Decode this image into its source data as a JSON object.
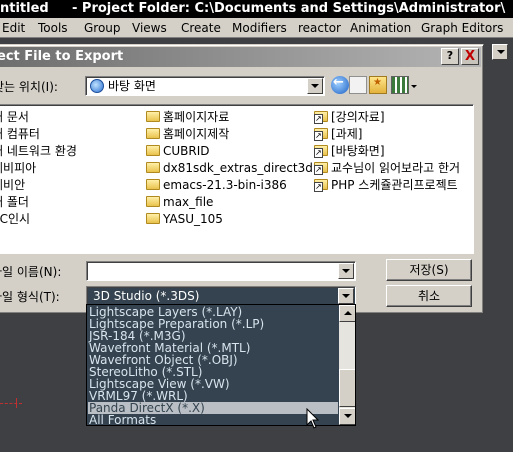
{
  "app": {
    "title_prefix": "ntitled",
    "title_project": "- Project Folder: C:\\Documents and Settings\\Administrator\\"
  },
  "menubar": {
    "items": [
      "Edit",
      "Tools",
      "Group",
      "Views",
      "Create",
      "Modifiers",
      "reactor",
      "Animation",
      "Graph Editors"
    ]
  },
  "dialog": {
    "title": "ect File to Export",
    "help_button": "?",
    "close_button": "X",
    "lookin_label": "찾는 위치(I):",
    "lookin_value": "바탕 화면",
    "files_col1": [
      "내 문서",
      "내 컴퓨터",
      "내 네트워크 환경",
      "웨비피아",
      "웨비안",
      "새 폴더",
      "SC인시"
    ],
    "files_col2": [
      "홈페이지자료",
      "홈페이지제작",
      "CUBRID",
      "dx81sdk_extras_direct3d",
      "emacs-21.3-bin-i386",
      "max_file",
      "YASU_105"
    ],
    "files_col3": [
      "[강의자료]",
      "[과제]",
      "[바탕화면]",
      "교수님이 읽어보라고 한거",
      "PHP 스케쥴관리프로젝트"
    ],
    "filename_label": "파일 이름(N):",
    "filename_value": "",
    "filetype_label": "파일 형식(T):",
    "filetype_value": "3D Studio (*.3DS)",
    "save_button": "저장(S)",
    "cancel_button": "취소"
  },
  "dropdown": {
    "options": [
      "Lightscape Layers (*.LAY)",
      "Lightscape Preparation (*.LP)",
      "JSR-184 (*.M3G)",
      "Wavefront Material (*.MTL)",
      "Wavefront Object (*.OBJ)",
      "StereoLitho (*.STL)",
      "Lightscape View (*.VW)",
      "VRML97 (*.WRL)",
      "Panda DirectX (*.X)",
      "All Formats"
    ],
    "selected_index": 8
  },
  "colors": {
    "dropdown_bg": "#34434f",
    "selection_bg": "#b9bfc4",
    "dialog_face": "#d4d0c8"
  }
}
